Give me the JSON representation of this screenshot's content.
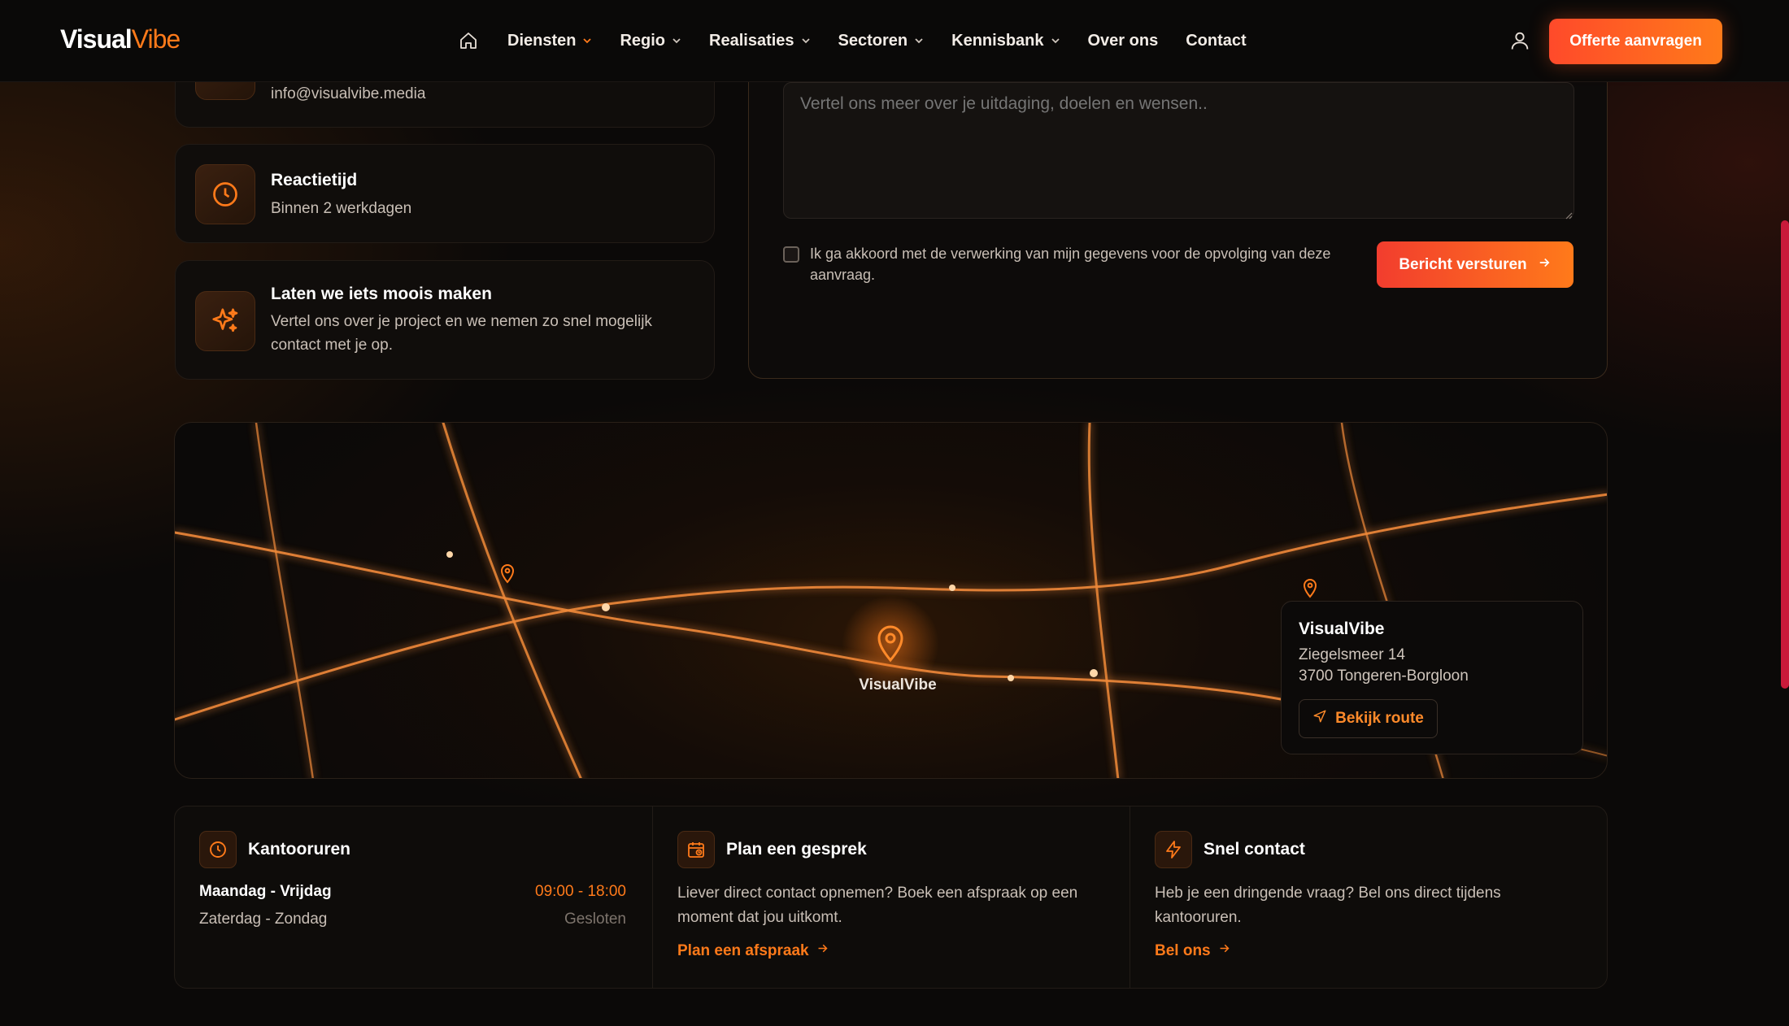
{
  "brand": {
    "logo_part1": "Visual",
    "logo_part2": "Vibe",
    "accent": "#ff7a1a"
  },
  "nav": {
    "home_icon": "home-icon",
    "items": [
      {
        "label": "Diensten",
        "dropdown": true
      },
      {
        "label": "Regio",
        "dropdown": true
      },
      {
        "label": "Realisaties",
        "dropdown": true
      },
      {
        "label": "Sectoren",
        "dropdown": true
      },
      {
        "label": "Kennisbank",
        "dropdown": true
      },
      {
        "label": "Over ons",
        "dropdown": false
      },
      {
        "label": "Contact",
        "dropdown": false
      }
    ],
    "user_icon": "user-icon",
    "cta_label": "Offerte aanvragen"
  },
  "contact_cards": [
    {
      "icon": "mail-icon",
      "text": "info@visualvibe.media"
    },
    {
      "icon": "clock-icon",
      "title": "Reactietijd",
      "text": "Binnen 2 werkdagen"
    },
    {
      "icon": "sparkles-icon",
      "title": "Laten we iets moois maken",
      "text": "Vertel ons over je project en we nemen zo snel mogelijk contact met je op."
    }
  ],
  "form": {
    "message_placeholder": "Vertel ons meer over je uitdaging, doelen en wensen..",
    "consent_label": "Ik ga akkoord met de verwerking van mijn gegevens voor de opvolging van deze aanvraag.",
    "consent_checked": false,
    "submit_label": "Bericht versturen"
  },
  "map": {
    "marker_label": "VisualVibe",
    "info": {
      "name": "VisualVibe",
      "street": "Ziegelsmeer 14",
      "city": "3700 Tongeren-Borgloon",
      "route_label": "Bekijk route"
    }
  },
  "info_row": {
    "office_hours": {
      "icon": "clock-icon",
      "title": "Kantooruren",
      "rows": [
        {
          "days": "Maandag - Vrijdag",
          "hours": "09:00 - 18:00"
        },
        {
          "days": "Zaterdag - Zondag",
          "hours": "Gesloten"
        }
      ]
    },
    "plan": {
      "icon": "calendar-icon",
      "title": "Plan een gesprek",
      "text": "Liever direct contact opnemen? Boek een afspraak op een moment dat jou uitkomt.",
      "link": "Plan een afspraak"
    },
    "quick": {
      "icon": "lightning-icon",
      "title": "Snel contact",
      "text": "Heb je een dringende vraag? Bel ons direct tijdens kantooruren.",
      "link": "Bel ons"
    }
  }
}
